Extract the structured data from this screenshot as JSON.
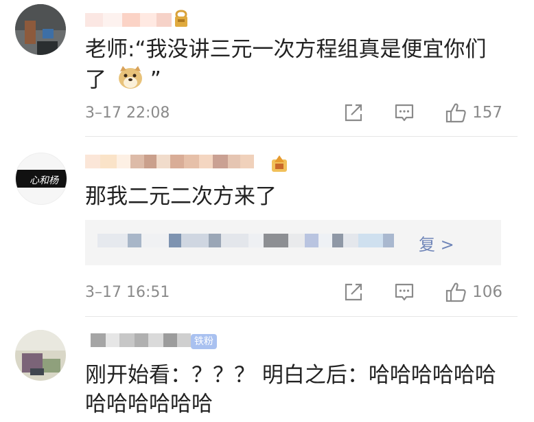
{
  "comments": [
    {
      "text_lines": [
        "老师:“我没讲三元一次方程组真是便宜你们",
        "了"
      ],
      "emoji_name": "doge-emoji",
      "close_quote": "”",
      "time": "3–17 22:08",
      "likes": "157"
    },
    {
      "text_lines": [
        "那我二元二次方来了"
      ],
      "quote_tail": "复 >",
      "time": "3–17 16:51",
      "likes": "106"
    },
    {
      "badge": "铁粉",
      "text_lines": [
        "刚开始看：？？？ 明白之后：哈哈哈哈哈哈",
        "哈哈哈哈哈哈"
      ]
    }
  ],
  "icons": {
    "share": "share-icon",
    "comment": "comment-icon",
    "like": "thumbs-up-icon"
  },
  "colors": {
    "text": "#222222",
    "meta": "#8a8a8a",
    "badge_bg": "#a9c1f0",
    "gold": "#d9a23a"
  }
}
